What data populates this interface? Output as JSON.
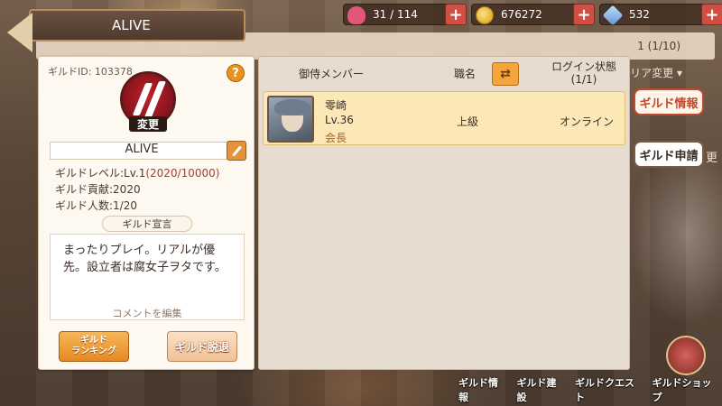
{
  "header": {
    "guild_tab": "ALIVE",
    "list_count": "1 (1/10)",
    "area_change": "リア変更 ▾",
    "side_fragment": "更"
  },
  "resources": [
    {
      "icon": "heart-icon",
      "value": "31 / 114",
      "plus": "+"
    },
    {
      "icon": "coin-icon",
      "value": "676272",
      "plus": "+"
    },
    {
      "icon": "gem-icon",
      "value": "532",
      "plus": "+"
    }
  ],
  "guild": {
    "id_text": "ギルドID: 103378",
    "help": "?",
    "emblem_change": "変更",
    "name": "ALIVE",
    "level_label": "ギルドレベル:Lv.1",
    "level_exp": "(2020/10000)",
    "contribution": "ギルド貢献:2020",
    "members": "ギルド人数:1/20",
    "declaration_label": "ギルド宣言",
    "declaration": "まったりプレイ。リアルが優先。設立者は腐女子ヲタです。",
    "edit_comment": "コメントを編集",
    "ranking_button": "ギルド\nランキング",
    "leave_button": "ギルド脱退"
  },
  "member_table": {
    "col_member": "御侍メンバー",
    "col_role": "職名",
    "swap": "⇄",
    "col_login": "ログイン状態\n(1/1)",
    "rows": [
      {
        "name": "零崎",
        "level": "Lv.36",
        "title": "会長",
        "role": "上級",
        "status": "オンライン"
      }
    ]
  },
  "side_tabs": {
    "info": "ギルド情報",
    "apply": "ギルド申請"
  },
  "bottom_nav": [
    "ギルド情報",
    "ギルド建設",
    "ギルドクエスト",
    "ギルドショップ"
  ]
}
